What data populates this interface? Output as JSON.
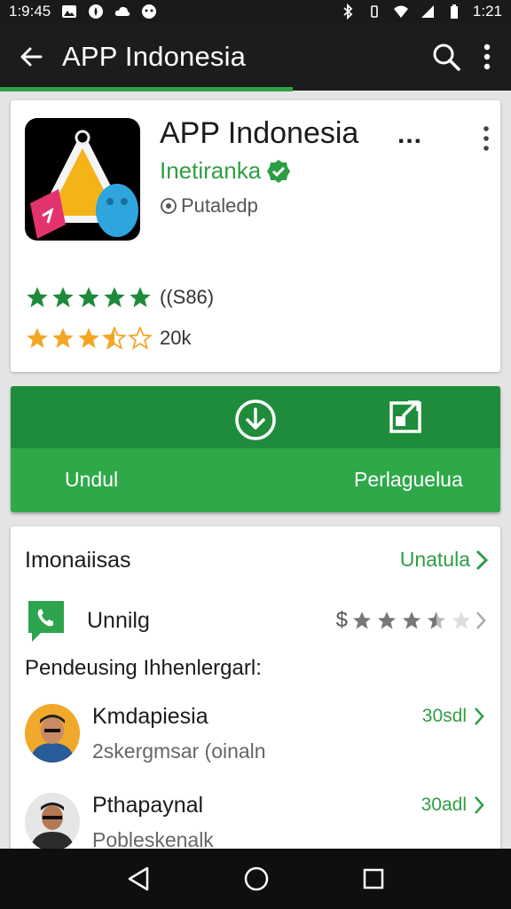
{
  "status_bar": {
    "time": "1:9:45",
    "right_text": "1:21"
  },
  "app_bar": {
    "title": "APP Indonesia"
  },
  "app": {
    "name": "APP Indonesia",
    "name_ellipsis": "...",
    "developer": "Inetiranka",
    "badge": "Putaledp",
    "rating_count": "((S86)",
    "reviews": "20k",
    "rating_stars": 5,
    "secondary_stars": 3.5
  },
  "actions": {
    "install_label": "Undul",
    "share_label": "Perlaguelua"
  },
  "section": {
    "title": "Imonaiisas",
    "more": "Unatula",
    "app_row": {
      "name": "Unnilg",
      "price": "$",
      "stars": 3.5
    },
    "subtitle": "Pendeusing Ihhenlergarl:",
    "people": [
      {
        "name": "Kmdapiesia",
        "sub": "2skergmsar (oinaln",
        "meta": "30sdl"
      },
      {
        "name": "Pthapaynal",
        "sub": "Pobleskenalk",
        "meta": "30adl"
      }
    ]
  },
  "colors": {
    "accent": "#2e9e44",
    "dark_bar": "#1c1c1c",
    "green_panel": "#2fa84a"
  }
}
